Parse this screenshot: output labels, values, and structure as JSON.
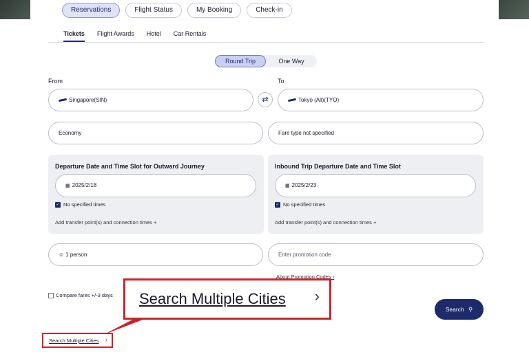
{
  "nav_pills": [
    "Reservations",
    "Flight Status",
    "My Booking",
    "Check-in"
  ],
  "tabs": [
    "Tickets",
    "Flight Awards",
    "Hotel",
    "Car Rentals"
  ],
  "trip_type": {
    "round_trip": "Round Trip",
    "one_way": "One Way"
  },
  "from": {
    "label": "From",
    "value": "Singapore(SIN)"
  },
  "to": {
    "label": "To",
    "value": "Tokyo (All)(TYO)"
  },
  "cabin_value": "Economy",
  "fare_value": "Fare type not specified",
  "outbound": {
    "title": "Departure Date and Time Slot for Outward Journey",
    "date": "2025/2/18",
    "no_times": "No specified times",
    "transfer": "Add transfer point(s) and connection times +"
  },
  "inbound": {
    "title": "Inbound Trip Departure Date and Time Slot",
    "date": "2025/2/23",
    "no_times": "No specified times",
    "transfer": "Add transfer point(s) and connection times +"
  },
  "passengers": "1 person",
  "promo_placeholder": "Enter promotion code",
  "promo_link": "About Promotion Codes",
  "compare_label": "Compare fares +/-3 days",
  "callout_text": "Search Multiple Cities",
  "search_label": "Search",
  "multi_city_link": "Search Multiple Cities",
  "colors": {
    "accent": "#1d2a6b",
    "highlight": "#cc2229"
  },
  "icons": [
    "swap-icon",
    "calendar-icon",
    "person-icon",
    "search-icon",
    "chevron-right-icon",
    "plane-icon"
  ]
}
